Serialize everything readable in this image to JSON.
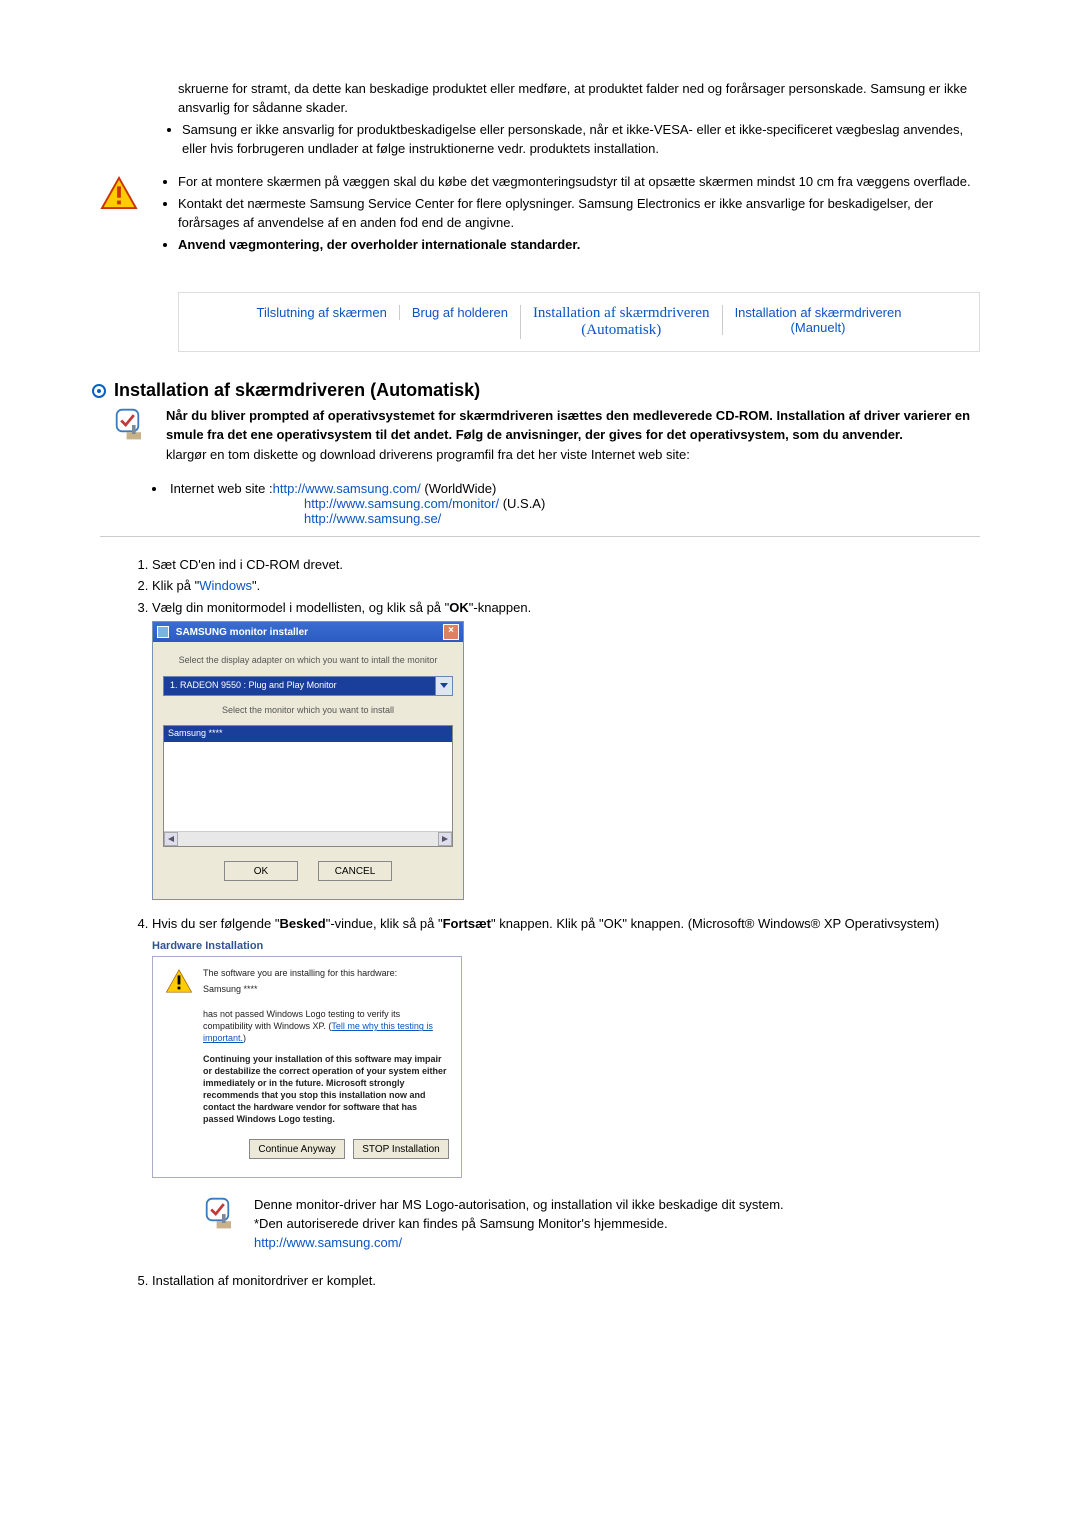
{
  "top": {
    "lead_fragment": "skruerne for stramt, da dette kan beskadige produktet eller medføre, at produktet falder ned og forårsager personskade. Samsung er ikke ansvarlig for sådanne skader.",
    "bullets_top": [
      "Samsung er ikke ansvarlig for produktbeskadigelse eller personskade, når et ikke-VESA- eller et ikke-specificeret vægbeslag anvendes, eller hvis forbrugeren undlader at følge instruktionerne vedr. produktets installation."
    ]
  },
  "warning_bullets": [
    "For at montere skærmen på væggen skal du købe det vægmonteringsudstyr til at opsætte skærmen mindst 10 cm fra væggens overflade.",
    "Kontakt det nærmeste Samsung Service Center for flere oplysninger. Samsung Electronics er ikke ansvarlige for beskadigelser, der forårsages af anvendelse af en anden fod end de angivne."
  ],
  "warning_bold": "Anvend vægmontering, der overholder internationale standarder.",
  "tabs": [
    {
      "label": "Tilslutning af skærmen"
    },
    {
      "label": "Brug af holderen"
    },
    {
      "label": "Installation af skærmdriveren",
      "sub": "(Automatisk)",
      "active": true
    },
    {
      "label": "Installation af skærmdriveren",
      "sub": "(Manuelt)"
    }
  ],
  "section": {
    "heading": "Installation af skærmdriveren (Automatisk)",
    "intro_bold": "Når du bliver prompted af operativsystemet for skærmdriveren isættes den medleverede CD-ROM. Installation af driver varierer en smule fra det ene operativsystem til det andet. Følg de anvisninger, der gives for det operativsystem, som du anvender.",
    "plain": "klargør en tom diskette og download driverens programfil fra det her viste Internet web site:"
  },
  "links": {
    "label": "Internet web site :",
    "items": [
      {
        "url": "http://www.samsung.com/",
        "suffix": " (WorldWide)"
      },
      {
        "url": "http://www.samsung.com/monitor/",
        "suffix": " (U.S.A)"
      },
      {
        "url": "http://www.samsung.se/",
        "suffix": ""
      }
    ]
  },
  "steps": {
    "s1": "Sæt CD'en ind i CD-ROM drevet.",
    "s2_a": "Klik på \"",
    "s2_link": "Windows",
    "s2_b": "\".",
    "s3_a": "Vælg din monitormodel i modellisten, og klik så på \"",
    "s3_bold": "OK",
    "s3_b": "\"-knappen.",
    "s4_a": "Hvis du ser følgende \"",
    "s4_b1": "Besked",
    "s4_c": "\"-vindue, klik så på \"",
    "s4_b2": "Fortsæt",
    "s4_d": "\" knappen. Klik på \"OK\" knappen. (Microsoft® Windows® XP Operativsystem)",
    "s5": "Installation af monitordriver er komplet."
  },
  "dlg1": {
    "title": "SAMSUNG monitor installer",
    "label1": "Select the display adapter on which you want to intall the monitor",
    "combo": "1. RADEON 9550 : Plug and Play Monitor",
    "label2": "Select the monitor which you want to install",
    "sel": "Samsung ****",
    "ok": "OK",
    "cancel": "CANCEL"
  },
  "dlg2": {
    "heading": "Hardware Installation",
    "line1": "The software you are installing for this hardware:",
    "line2": "Samsung ****",
    "line3a": "has not passed Windows Logo testing to verify its compatibility with Windows XP. (",
    "line3link": "Tell me why this testing is important.",
    "line3b": ")",
    "warn": "Continuing your installation of this software may impair or destabilize the correct operation of your system either immediately or in the future. Microsoft strongly recommends that you stop this installation now and contact the hardware vendor for software that has passed Windows Logo testing.",
    "btn1": "Continue Anyway",
    "btn2": "STOP Installation"
  },
  "lower_note": {
    "l1": "Denne monitor-driver har MS Logo-autorisation, og installation vil ikke beskadige dit system.",
    "l2": "*Den autoriserede driver kan findes på Samsung Monitor's hjemmeside.",
    "link": "http://www.samsung.com/"
  }
}
